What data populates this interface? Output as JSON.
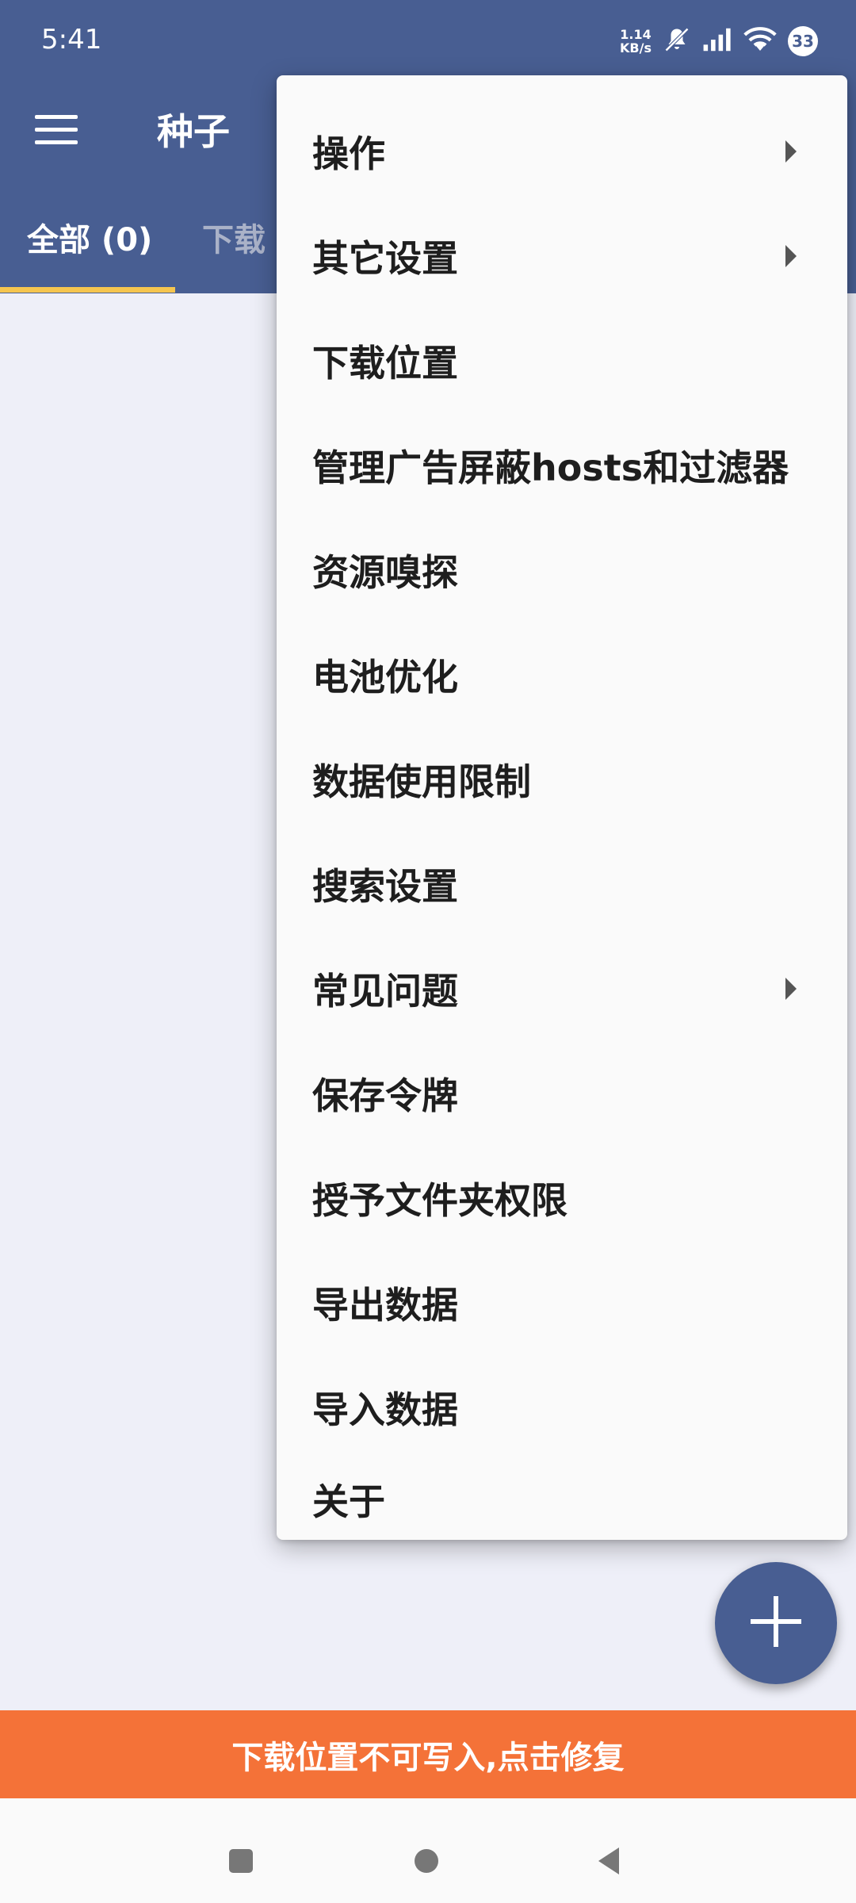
{
  "status_bar": {
    "time": "5:41",
    "net_speed_value": "1.14",
    "net_speed_unit": "KB/s",
    "badge": "33"
  },
  "app_bar": {
    "menu_icon": "hamburger-menu-icon",
    "title": "种子"
  },
  "tabs": [
    {
      "label": "全部 (0)",
      "selected": true
    },
    {
      "label": "下载",
      "selected": false
    }
  ],
  "overflow_menu": {
    "items": [
      {
        "label": "操作",
        "has_submenu": true
      },
      {
        "label": "其它设置",
        "has_submenu": true
      },
      {
        "label": "下载位置",
        "has_submenu": false
      },
      {
        "label": "管理广告屏蔽hosts和过滤器",
        "has_submenu": false
      },
      {
        "label": "资源嗅探",
        "has_submenu": false
      },
      {
        "label": "电池优化",
        "has_submenu": false
      },
      {
        "label": "数据使用限制",
        "has_submenu": false
      },
      {
        "label": "搜索设置",
        "has_submenu": false
      },
      {
        "label": "常见问题",
        "has_submenu": true
      },
      {
        "label": "保存令牌",
        "has_submenu": false
      },
      {
        "label": "授予文件夹权限",
        "has_submenu": false
      },
      {
        "label": "导出数据",
        "has_submenu": false
      },
      {
        "label": "导入数据",
        "has_submenu": false
      },
      {
        "label": "关于",
        "has_submenu": false
      }
    ]
  },
  "fab": {
    "icon": "plus-icon"
  },
  "warning": {
    "text": "下载位置不可写入,点击修复"
  },
  "colors": {
    "primary": "#485e92",
    "tab_indicator": "#f5c54f",
    "warning": "#f47238",
    "background": "#eeeff8"
  }
}
